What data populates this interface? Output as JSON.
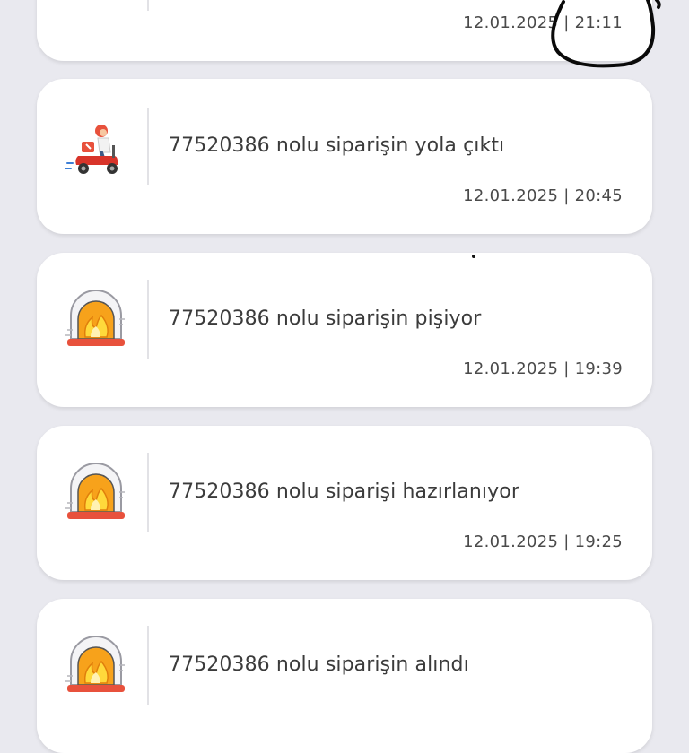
{
  "notifications": [
    {
      "icon": "oven-fire-icon",
      "message": "",
      "datetime": "12.01.2025 | 21:11"
    },
    {
      "icon": "delivery-scooter-icon",
      "message": "77520386 nolu siparişin yola çıktı",
      "datetime": "12.01.2025 | 20:45"
    },
    {
      "icon": "oven-fire-icon",
      "message": "77520386 nolu siparişin pişiyor",
      "datetime": "12.01.2025 | 19:39"
    },
    {
      "icon": "oven-fire-icon",
      "message": "77520386 nolu siparişi hazırlanıyor",
      "datetime": "12.01.2025 | 19:25"
    },
    {
      "icon": "oven-fire-icon",
      "message": "77520386 nolu siparişin alındı",
      "datetime": ""
    }
  ],
  "colors": {
    "background": "#e9e9ef",
    "card": "#ffffff",
    "text": "#3b3b3b",
    "oven_red": "#e8513c",
    "flame_orange": "#f7a21b",
    "flame_yellow": "#ffd93b"
  }
}
